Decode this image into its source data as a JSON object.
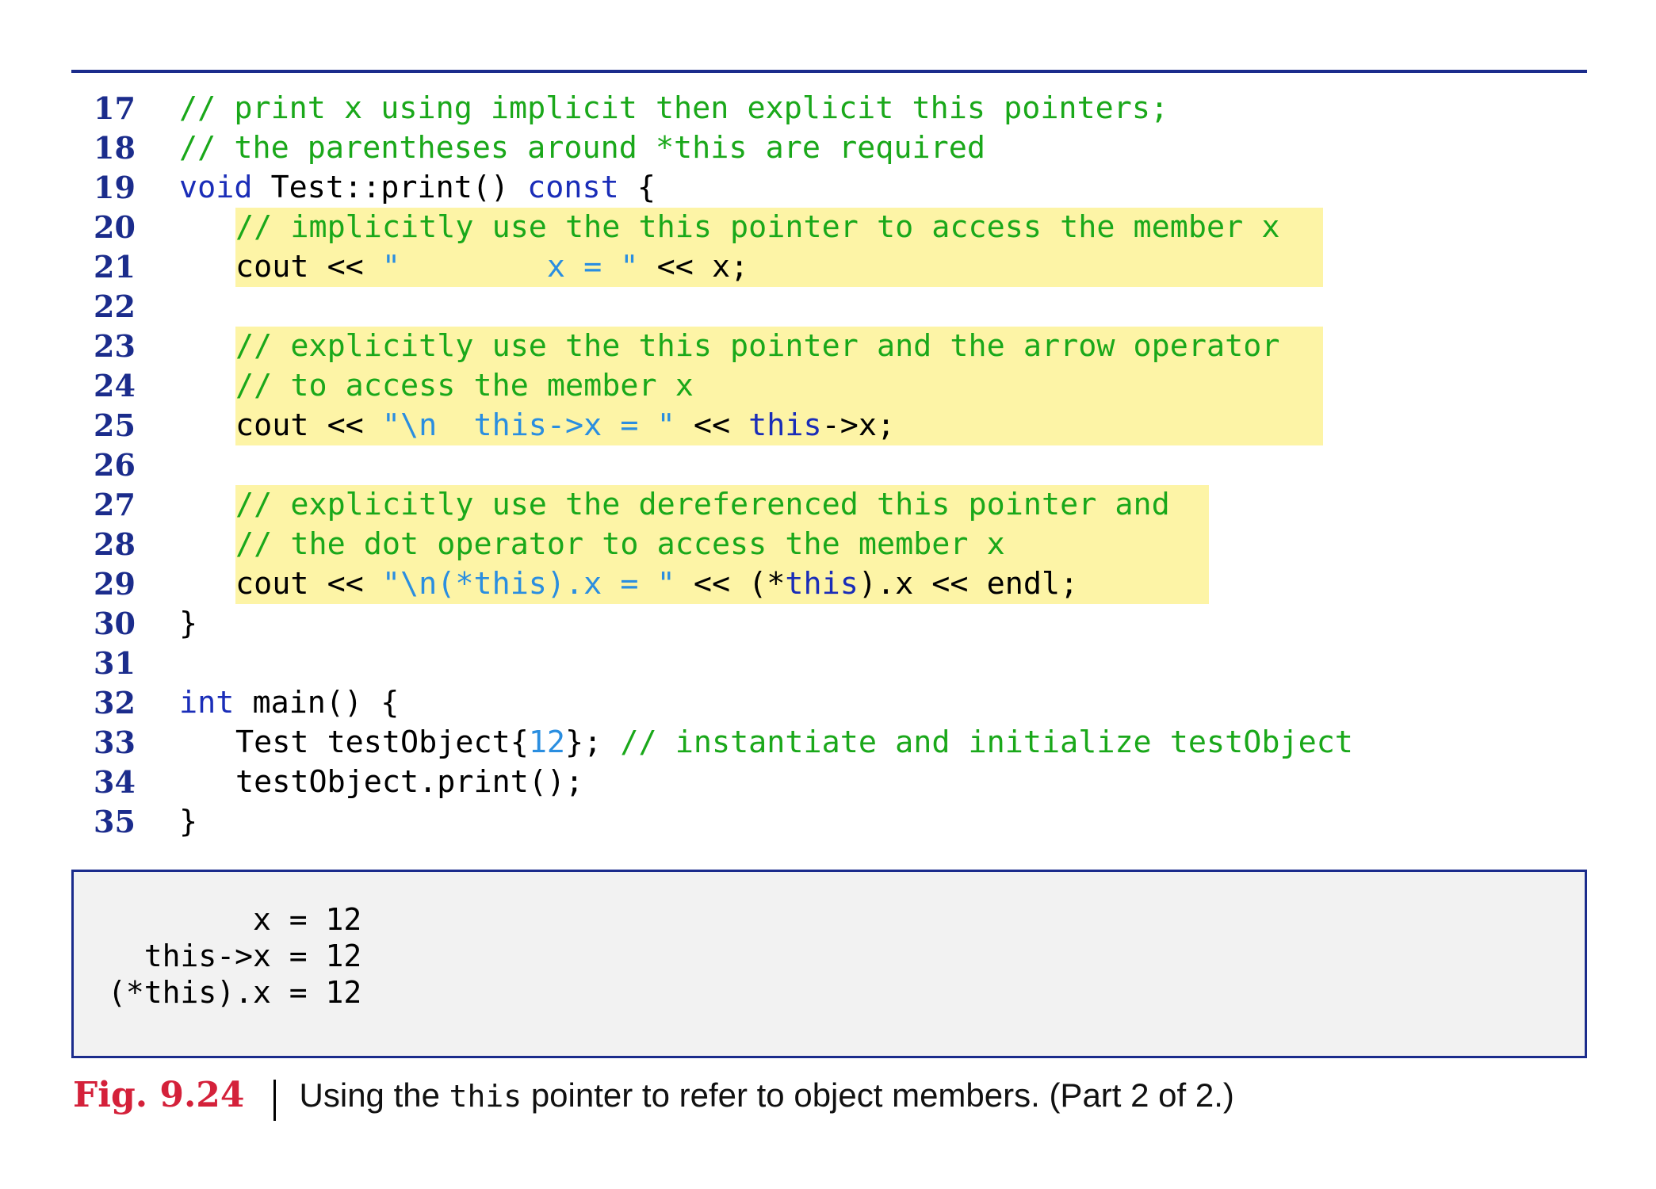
{
  "code_lines": [
    {
      "n": "17",
      "parts": [
        {
          "t": "// print x using implicit then explicit this pointers;",
          "c": "cm"
        }
      ]
    },
    {
      "n": "18",
      "parts": [
        {
          "t": "// the parentheses around *this are required",
          "c": "cm"
        }
      ]
    },
    {
      "n": "19",
      "parts": [
        {
          "t": "void",
          "c": "kw"
        },
        {
          "t": " Test::print() ",
          "c": "pl"
        },
        {
          "t": "const",
          "c": "kw"
        },
        {
          "t": " {",
          "c": "pl"
        }
      ]
    },
    {
      "n": "20",
      "indent": true,
      "parts": [
        {
          "t": "// implicitly use the this pointer to access the member x",
          "c": "cm"
        }
      ]
    },
    {
      "n": "21",
      "indent": true,
      "parts": [
        {
          "t": "cout << ",
          "c": "pl"
        },
        {
          "t": "\"        x = \"",
          "c": "st"
        },
        {
          "t": " << x;",
          "c": "pl"
        }
      ]
    },
    {
      "n": "22",
      "parts": []
    },
    {
      "n": "23",
      "indent": true,
      "parts": [
        {
          "t": "// explicitly use the this pointer and the arrow operator",
          "c": "cm"
        }
      ]
    },
    {
      "n": "24",
      "indent": true,
      "parts": [
        {
          "t": "// to access the member x",
          "c": "cm"
        }
      ]
    },
    {
      "n": "25",
      "indent": true,
      "parts": [
        {
          "t": "cout << ",
          "c": "pl"
        },
        {
          "t": "\"\\n  this->x = \"",
          "c": "st"
        },
        {
          "t": " << ",
          "c": "pl"
        },
        {
          "t": "this",
          "c": "kw"
        },
        {
          "t": "->x;",
          "c": "pl"
        }
      ]
    },
    {
      "n": "26",
      "parts": []
    },
    {
      "n": "27",
      "indent": true,
      "parts": [
        {
          "t": "// explicitly use the dereferenced this pointer and",
          "c": "cm"
        }
      ]
    },
    {
      "n": "28",
      "indent": true,
      "parts": [
        {
          "t": "// the dot operator to access the member x",
          "c": "cm"
        }
      ]
    },
    {
      "n": "29",
      "indent": true,
      "parts": [
        {
          "t": "cout << ",
          "c": "pl"
        },
        {
          "t": "\"\\n(*this).x = \"",
          "c": "st"
        },
        {
          "t": " << (*",
          "c": "pl"
        },
        {
          "t": "this",
          "c": "kw"
        },
        {
          "t": ").x << endl;",
          "c": "pl"
        }
      ]
    },
    {
      "n": "30",
      "parts": [
        {
          "t": "}",
          "c": "pl"
        }
      ]
    },
    {
      "n": "31",
      "parts": []
    },
    {
      "n": "32",
      "parts": [
        {
          "t": "int",
          "c": "kw"
        },
        {
          "t": " main() {",
          "c": "pl"
        }
      ]
    },
    {
      "n": "33",
      "indent": true,
      "parts": [
        {
          "t": "Test testObject{",
          "c": "pl"
        },
        {
          "t": "12",
          "c": "nm"
        },
        {
          "t": "}; ",
          "c": "pl"
        },
        {
          "t": "// instantiate and initialize testObject",
          "c": "cm"
        }
      ]
    },
    {
      "n": "34",
      "indent": true,
      "parts": [
        {
          "t": "testObject.print();",
          "c": "pl"
        }
      ]
    },
    {
      "n": "35",
      "parts": [
        {
          "t": "}",
          "c": "pl"
        }
      ]
    }
  ],
  "output_lines": [
    "        x = 12",
    "  this->x = 12",
    "(*this).x = 12"
  ],
  "caption": {
    "figure": "Fig. 9.24",
    "text_before": "Using the ",
    "code_word": "this",
    "text_after": " pointer to refer to object members. (Part 2 of 2.)"
  },
  "colors": {
    "rule": "#1b2c8c",
    "line_numbers": "#1b2c8c",
    "comment": "#1aa81a",
    "keyword": "#1a2db8",
    "string": "#2a8ee0",
    "highlight": "#fdf4a6",
    "figure_label": "#d4213a"
  }
}
